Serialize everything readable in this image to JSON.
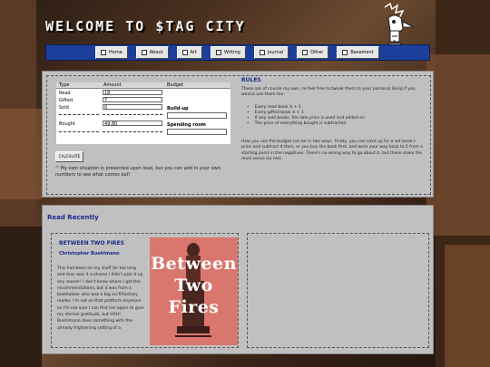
{
  "header": {
    "site_title": "WELCOME TO $TAG CITY"
  },
  "nav": {
    "items": [
      {
        "label": "Home",
        "icon": "home-icon"
      },
      {
        "label": "About",
        "icon": "info-icon"
      },
      {
        "label": "Art",
        "icon": "art-icon"
      },
      {
        "label": "Writing",
        "icon": "pencil-icon"
      },
      {
        "label": "Journal",
        "icon": "journal-icon"
      },
      {
        "label": "Other",
        "icon": "folder-icon"
      },
      {
        "label": "Basement",
        "icon": "stairs-icon"
      }
    ]
  },
  "calculator": {
    "headers": {
      "type": "Type",
      "amount": "Amount",
      "budget": "Budget"
    },
    "rows": [
      {
        "label": "Read",
        "value": "18"
      },
      {
        "label": "Gifted",
        "value": "7"
      },
      {
        "label": "Sold",
        "value": "0"
      },
      {
        "label": "Bought",
        "value": "49.80"
      }
    ],
    "buildup_label": "Build-up",
    "spending_label": "Spending room",
    "button_label": "CALCULATE",
    "note": "^ My own situation is presented upon load, but you can add in your own numbers to see what comes out!"
  },
  "rules": {
    "title": "RULES",
    "intro": "These are of course my own, so feel free to tweak them to your personal liking if you wanna use them too:",
    "items": [
      "Every read book is + 1",
      "Every gifted book is + 1",
      "If any sold books, the sale price is used and added on",
      "The price of everything bought is subtracted"
    ],
    "body": "How you use the budget can be in two ways. Firstly, you can save up for a set book's price and subtract it then, or you buy the book first, and work your way back to 0 from a starting point in the negatives. There's no wrong way to go about it, but these make the most sense (to me)."
  },
  "read_recently": {
    "title": "Read Recently",
    "book": {
      "title": "BETWEEN TWO FIRES",
      "author": "Christopher Buehlmann",
      "review": "This had been on my shelf for too long and man was it a shame I didn't pick it up any sooner! I don't know where I got the recommendations, but it was from a booktokker who was a big sci-fi/fantasy reader. I'm not on that platform anymore so I'm not sure I can find her again to give my eternal gratitude, but HAH! Buehlmann does something with the already frightening setting of a",
      "cover_words": [
        "Between",
        "Two",
        "Fires"
      ]
    }
  },
  "colors": {
    "panel": "#c0c0c0",
    "nav": "#1c3f9c",
    "accent_text": "#1a2a8a",
    "cover": "#d9776e"
  }
}
